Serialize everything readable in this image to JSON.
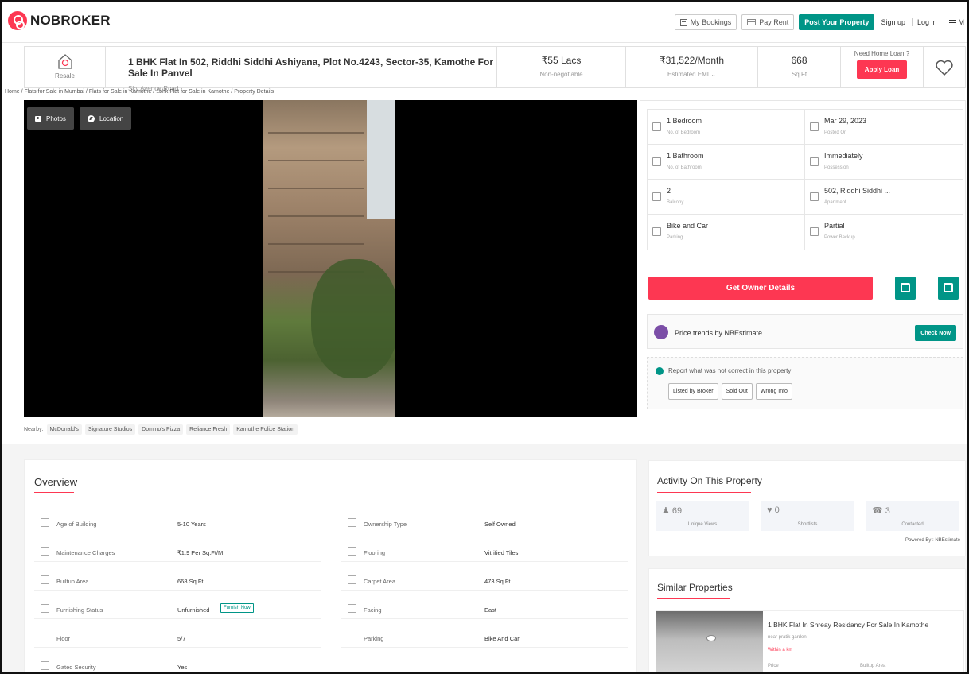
{
  "nav": {
    "logo_text": "NOBROKER",
    "my_bookings": "My Bookings",
    "pay_rent": "Pay Rent",
    "post_property": "Post Your Property",
    "sign_up": "Sign up",
    "log_in": "Log in",
    "menu": "M"
  },
  "header": {
    "resale_label": "Resale",
    "title": "1 BHK Flat In 502, Riddhi Siddhi Ashiyana, Plot No.4243, Sector-35, Kamothe For Sale In Panvel",
    "subtitle": "Sky Avenue Road",
    "price": "₹55 Lacs",
    "price_note": "Non-negotiable",
    "emi": "₹31,522/Month",
    "emi_note": "Estimated EMI ⌄",
    "area": "668",
    "area_unit": "Sq.Ft",
    "loan_question": "Need Home Loan ?",
    "apply_loan": "Apply Loan"
  },
  "breadcrumb": "Home / Flats for Sale in Mumbai / Flats for Sale in Kamothe / 1bhk Flat for Sale in Kamothe / Property Details",
  "gallery": {
    "photos_label": "Photos",
    "location_label": "Location"
  },
  "nearby": {
    "label": "Nearby:",
    "places": [
      "McDonald's",
      "Signature Studios",
      "Domino's Pizza",
      "Reliance Fresh",
      "Kamothe Police Station"
    ]
  },
  "details": [
    {
      "value": "1 Bedroom",
      "label": "No. of Bedroom",
      "icon": "bed-icon"
    },
    {
      "value": "Mar 29, 2023",
      "label": "Posted On",
      "icon": "calendar-icon"
    },
    {
      "value": "1 Bathroom",
      "label": "No. of Bathroom",
      "icon": "bath-icon"
    },
    {
      "value": "Immediately",
      "label": "Possession",
      "icon": "key-icon"
    },
    {
      "value": "2",
      "label": "Balcony",
      "icon": "balcony-icon"
    },
    {
      "value": "502, Riddhi Siddhi ...",
      "label": "Apartment",
      "icon": "building-icon"
    },
    {
      "value": "Bike and Car",
      "label": "Parking",
      "icon": "car-icon"
    },
    {
      "value": "Partial",
      "label": "Power Backup",
      "icon": "battery-icon"
    }
  ],
  "actions": {
    "owner_details": "Get Owner Details"
  },
  "trends": {
    "text": "Price trends by NBEstimate",
    "button": "Check Now"
  },
  "report": {
    "text": "Report what was not correct in this property",
    "buttons": [
      "Listed by Broker",
      "Sold Out",
      "Wrong Info"
    ]
  },
  "overview": {
    "title": "Overview",
    "rows": [
      {
        "key": "Age of Building",
        "value": "5-10 Years",
        "icon": "calendar-icon"
      },
      {
        "key": "Ownership Type",
        "value": "Self Owned",
        "icon": "user-icon"
      },
      {
        "key": "Maintenance Charges",
        "value": "₹1.9 Per Sq.Ft/M",
        "icon": "tools-icon"
      },
      {
        "key": "Flooring",
        "value": "Vitrified Tiles",
        "icon": "tiles-icon"
      },
      {
        "key": "Builtup Area",
        "value": "668 Sq.Ft",
        "icon": "building-icon"
      },
      {
        "key": "Carpet Area",
        "value": "473 Sq.Ft",
        "icon": "floorplan-icon"
      },
      {
        "key": "Furnishing Status",
        "value": "Unfurnished",
        "icon": "sofa-icon"
      },
      {
        "key": "Facing",
        "value": "East",
        "icon": "compass-icon"
      },
      {
        "key": "Floor",
        "value": "5/7",
        "icon": "floor-icon"
      },
      {
        "key": "Parking",
        "value": "Bike And Car",
        "icon": "car-icon"
      },
      {
        "key": "Gated Security",
        "value": "Yes",
        "icon": "guard-icon"
      }
    ],
    "furnish_now": "Furnish Now"
  },
  "activity": {
    "title": "Activity On This Property",
    "stats": [
      {
        "number": "69",
        "label": "Unique Views",
        "icon": "user-icon"
      },
      {
        "number": "0",
        "label": "Shortlists",
        "icon": "heart-icon"
      },
      {
        "number": "3",
        "label": "Contacted",
        "icon": "phone-icon"
      }
    ],
    "powered_by": "Powered By : NBEstimate"
  },
  "similar": {
    "title": "Similar Properties",
    "name": "1 BHK Flat In Shreay Residancy For Sale In Kamothe",
    "sub": "near pratik garden",
    "distance": "Within a km",
    "price_label": "Price",
    "area_label": "Builtup Area"
  },
  "colors": {
    "brand_red": "#fd3752",
    "teal": "#009587",
    "purple": "#7b4ea7"
  }
}
